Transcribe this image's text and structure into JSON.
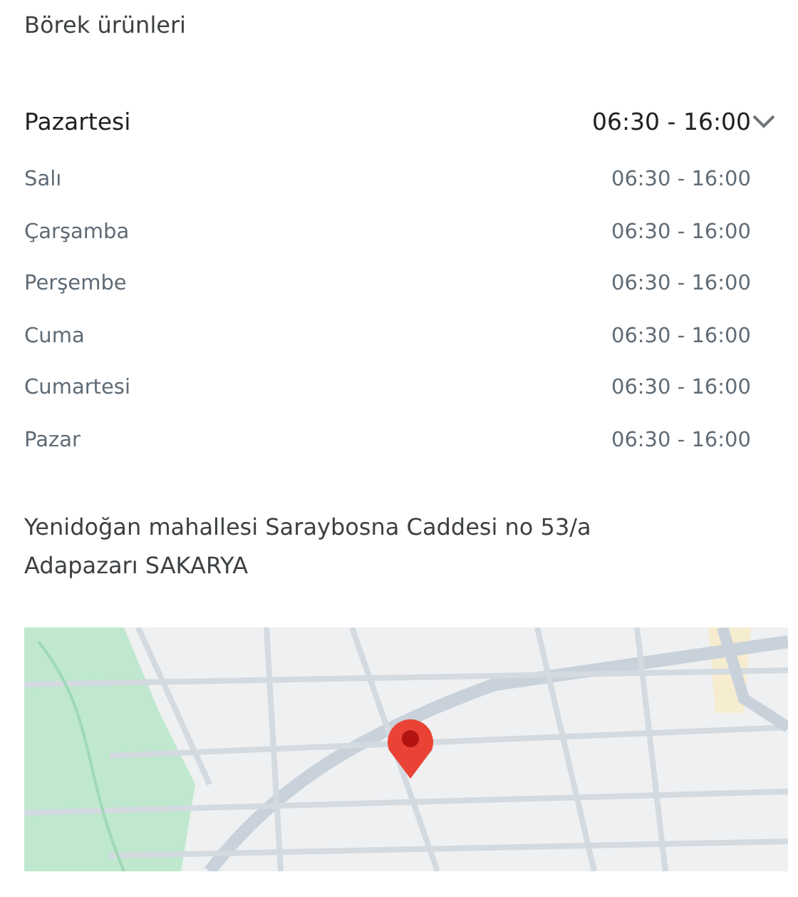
{
  "title": "Börek ürünleri",
  "hours": {
    "expanded": true,
    "days": [
      {
        "day": "Pazartesi",
        "time": "06:30 - 16:00",
        "today": true
      },
      {
        "day": "Salı",
        "time": "06:30 - 16:00",
        "today": false
      },
      {
        "day": "Çarşamba",
        "time": "06:30 - 16:00",
        "today": false
      },
      {
        "day": "Perşembe",
        "time": "06:30 - 16:00",
        "today": false
      },
      {
        "day": "Cuma",
        "time": "06:30 - 16:00",
        "today": false
      },
      {
        "day": "Cumartesi",
        "time": "06:30 - 16:00",
        "today": false
      },
      {
        "day": "Pazar",
        "time": "06:30 - 16:00",
        "today": false
      }
    ]
  },
  "address": "Yenidoğan mahallesi Saraybosna Caddesi no 53/a Adapazarı SAKARYA"
}
